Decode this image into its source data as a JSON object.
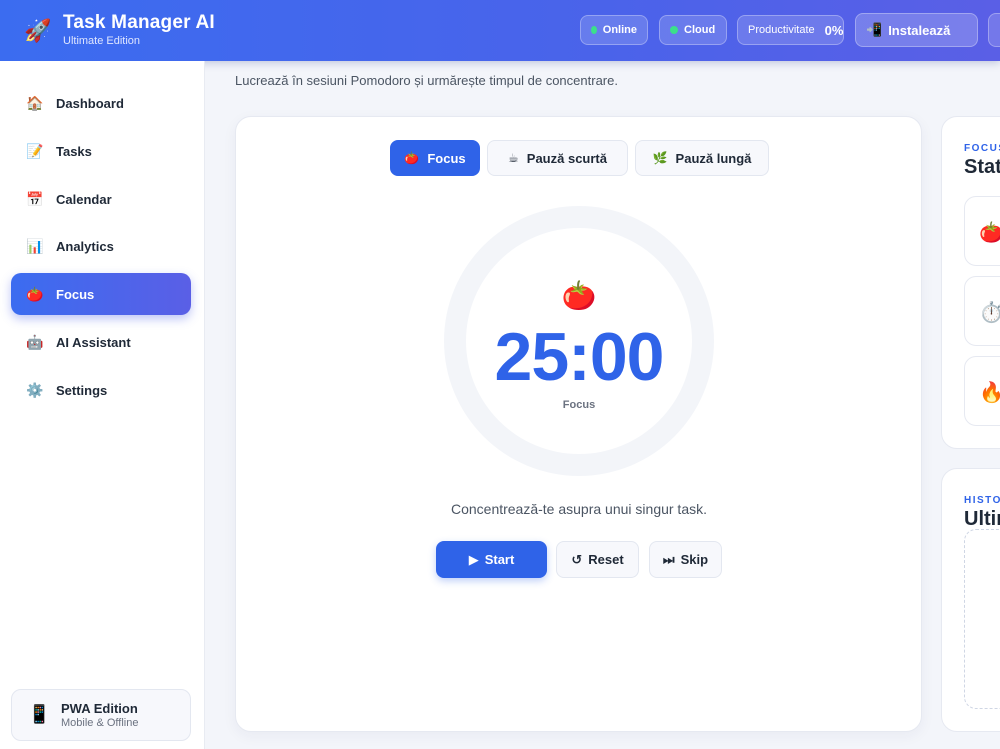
{
  "header": {
    "logo_icon": "rocket-icon",
    "title": "Task Manager AI",
    "subtitle": "Ultimate Edition",
    "online_label": "Online",
    "cloud_label": "Cloud",
    "productivity_label": "Productivitate",
    "productivity_value": "0%",
    "install_label": "Instalează"
  },
  "sidebar": {
    "items": [
      {
        "label": "Dashboard",
        "icon": "house-icon"
      },
      {
        "label": "Tasks",
        "icon": "memo-icon"
      },
      {
        "label": "Calendar",
        "icon": "calendar-icon"
      },
      {
        "label": "Analytics",
        "icon": "bar-chart-icon"
      },
      {
        "label": "Focus",
        "icon": "tomato-icon",
        "active": true
      },
      {
        "label": "AI Assistant",
        "icon": "robot-icon"
      },
      {
        "label": "Settings",
        "icon": "gear-icon"
      }
    ],
    "pwa": {
      "title": "PWA Edition",
      "subtitle": "Mobile & Offline",
      "icon": "mobile-phone-icon"
    }
  },
  "main": {
    "intro": "Lucrează în sesiuni Pomodoro și urmărește timpul de concentrare.",
    "tabs": [
      {
        "label": "Focus",
        "icon": "tomato-icon",
        "active": true
      },
      {
        "label": "Pauză scurtă",
        "icon": "coffee-icon"
      },
      {
        "label": "Pauză lungă",
        "icon": "leaf-icon"
      }
    ],
    "timer": {
      "value": "25:00",
      "label": "Focus",
      "icon": "tomato-icon"
    },
    "hint": "Concentrează-te asupra unui singur task.",
    "buttons": {
      "start": "Start",
      "reset": "Reset",
      "skip": "Skip"
    }
  },
  "right": {
    "stats_eyebrow": "FOCUS",
    "stats_title": "Stat",
    "history_eyebrow": "HISTO",
    "history_title": "Ultin",
    "stat_icons": [
      "tomato-icon",
      "stopwatch-icon",
      "fire-icon"
    ]
  },
  "colors": {
    "accent": "#2f63e8",
    "header_start": "#3b6cf0",
    "header_end": "#5a5fe6",
    "online_dot": "#3be08a"
  }
}
